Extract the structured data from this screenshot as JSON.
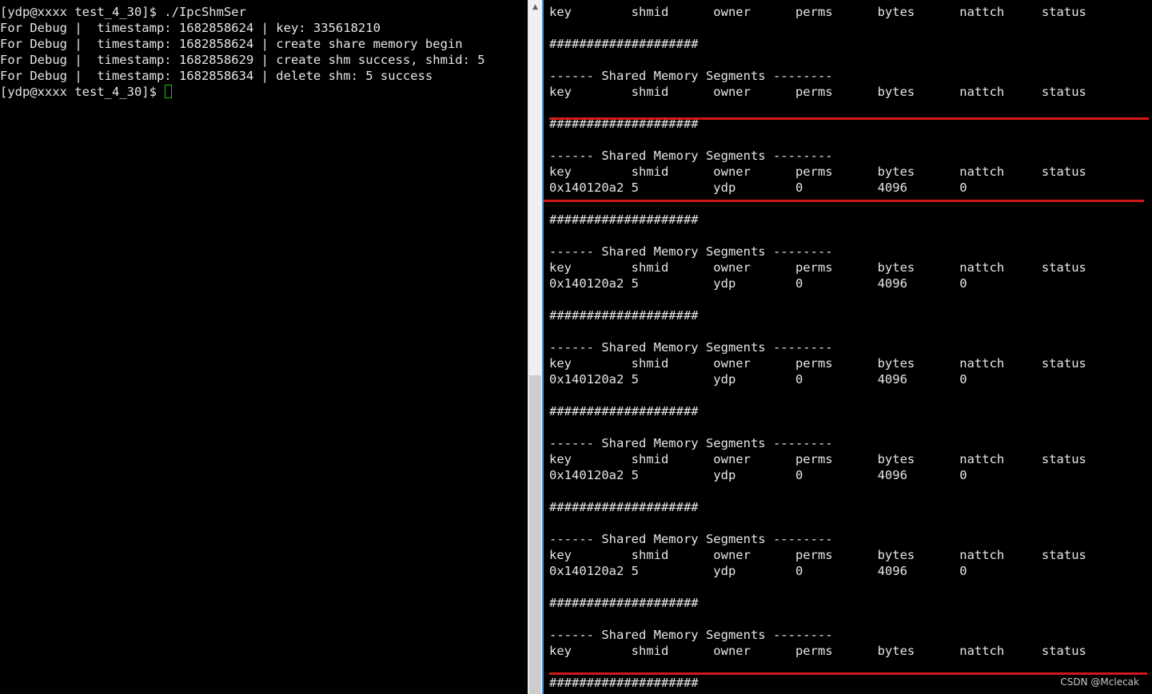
{
  "left_terminal": {
    "lines": [
      "[ydp@xxxx test_4_30]$ ./IpcShmSer",
      "For Debug |  timestamp: 1682858624 | key: 335618210",
      "For Debug |  timestamp: 1682858624 | create share memory begin",
      "For Debug |  timestamp: 1682858629 | create shm success, shmid: 5",
      "For Debug |  timestamp: 1682858634 | delete shm: 5 success"
    ],
    "prompt": "[ydp@xxxx test_4_30]$ "
  },
  "right_terminal": {
    "lines": [
      "key        shmid      owner      perms      bytes      nattch     status",
      "",
      "####################",
      "",
      "------ Shared Memory Segments --------",
      "key        shmid      owner      perms      bytes      nattch     status",
      "",
      "####################",
      "",
      "------ Shared Memory Segments --------",
      "key        shmid      owner      perms      bytes      nattch     status",
      "0x140120a2 5          ydp        0          4096       0",
      "",
      "####################",
      "",
      "------ Shared Memory Segments --------",
      "key        shmid      owner      perms      bytes      nattch     status",
      "0x140120a2 5          ydp        0          4096       0",
      "",
      "####################",
      "",
      "------ Shared Memory Segments --------",
      "key        shmid      owner      perms      bytes      nattch     status",
      "0x140120a2 5          ydp        0          4096       0",
      "",
      "####################",
      "",
      "------ Shared Memory Segments --------",
      "key        shmid      owner      perms      bytes      nattch     status",
      "0x140120a2 5          ydp        0          4096       0",
      "",
      "####################",
      "",
      "------ Shared Memory Segments --------",
      "key        shmid      owner      perms      bytes      nattch     status",
      "0x140120a2 5          ydp        0          4096       0",
      "",
      "####################",
      "",
      "------ Shared Memory Segments --------",
      "key        shmid      owner      perms      bytes      nattch     status",
      "",
      "####################"
    ]
  },
  "scrollbar": {
    "up_arrow": "▲"
  },
  "watermark": "CSDN @Mclecak",
  "colors": {
    "background": "#000000",
    "text": "#e6e6e6",
    "cursor": "#00cc00",
    "annotation": "#d01818"
  }
}
